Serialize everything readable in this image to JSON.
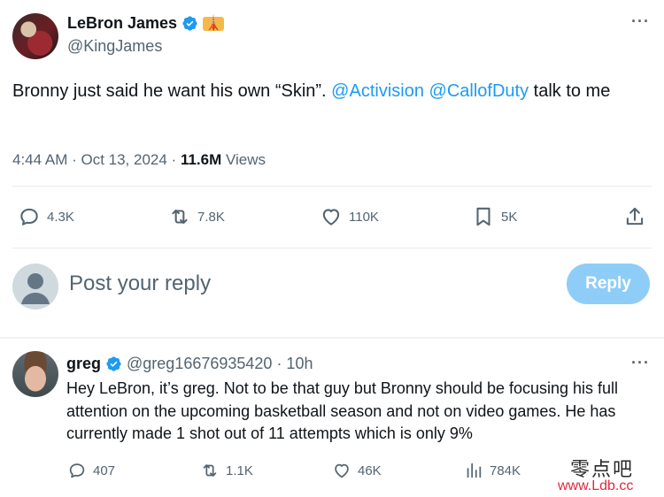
{
  "tweet": {
    "author_name": "LeBron James",
    "author_emoji": "🗼",
    "author_handle": "@KingJames",
    "text_prefix": "Bronny just said he want his own “Skin”.",
    "mention_1": "@Activision",
    "mention_2": "@CallofDuty",
    "text_suffix": "talk to me",
    "time": "4:44 AM · Oct 13, 2024 ·",
    "views_count": "11.6M",
    "views_label": "Views",
    "stats": {
      "replies": "4.3K",
      "retweets": "7.8K",
      "likes": "110K",
      "bookmarks": "5K"
    }
  },
  "reply_composer": {
    "placeholder": "Post your reply",
    "button_label": "Reply"
  },
  "reply": {
    "author_name": "greg",
    "author_handle": "@greg16676935420",
    "time": "· 10h",
    "text": "Hey LeBron, it’s greg. Not to be that guy but Bronny should be focusing his full attention on the upcoming basketball season and not on video games. He has currently made 1 shot out of 11 attempts which is only 9%",
    "stats": {
      "replies": "407",
      "retweets": "1.1K",
      "likes": "46K",
      "views": "784K"
    }
  },
  "watermark": {
    "cn_text": "零点吧",
    "url": "www.Ldb.cc"
  },
  "colors": {
    "accent": "#1d9bf0",
    "muted": "#536471",
    "reply_button": "#8ecdf7",
    "watermark_url": "#e0283d"
  },
  "icons": [
    "verified-badge-icon",
    "more-icon",
    "reply-icon",
    "retweet-icon",
    "like-icon",
    "bookmark-icon",
    "share-icon",
    "views-icon",
    "default-avatar-icon"
  ]
}
